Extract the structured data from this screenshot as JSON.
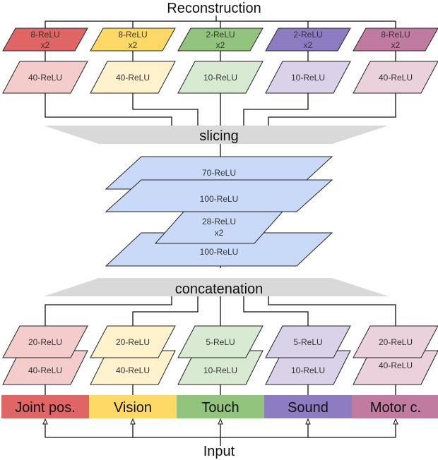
{
  "title_top": "Reconstruction",
  "slicing_label": "slicing",
  "concat_label": "concatenation",
  "input_label": "Input",
  "colors": {
    "strong": [
      "#e06666",
      "#ffd966",
      "#93c47d",
      "#8e7cc3",
      "#c27ba0"
    ],
    "light": [
      "#f4cccc",
      "#fff2cc",
      "#d9ead3",
      "#d9d2e9",
      "#ead1dc"
    ],
    "shared": "#c9daf8",
    "funnel": "#d9d9d9"
  },
  "modalities": [
    {
      "name": "Joint pos.",
      "dec_out": [
        "8-ReLU",
        "x2"
      ],
      "dec_hidden": "40-ReLU",
      "enc_top": "20-ReLU",
      "enc_bottom": "40-ReLU"
    },
    {
      "name": "Vision",
      "dec_out": [
        "8-ReLU",
        "x2"
      ],
      "dec_hidden": "40-ReLU",
      "enc_top": "20-ReLU",
      "enc_bottom": "40-ReLU"
    },
    {
      "name": "Touch",
      "dec_out": [
        "2-ReLU",
        "x2"
      ],
      "dec_hidden": "10-ReLU",
      "enc_top": "5-ReLU",
      "enc_bottom": "10-ReLU"
    },
    {
      "name": "Sound",
      "dec_out": [
        "2-ReLU",
        "x2"
      ],
      "dec_hidden": "10-ReLU",
      "enc_top": "5-ReLU",
      "enc_bottom": "10-ReLU"
    },
    {
      "name": "Motor c.",
      "dec_out": [
        "8-ReLU",
        "x2"
      ],
      "dec_hidden": "40-ReLU",
      "enc_top": "20-ReLU",
      "enc_bottom": "40-ReLU"
    }
  ],
  "shared_layers": {
    "top": "70-ReLU",
    "second": "100-ReLU",
    "latent": [
      "28-ReLU",
      "x2"
    ],
    "bottom": "100-ReLU"
  }
}
